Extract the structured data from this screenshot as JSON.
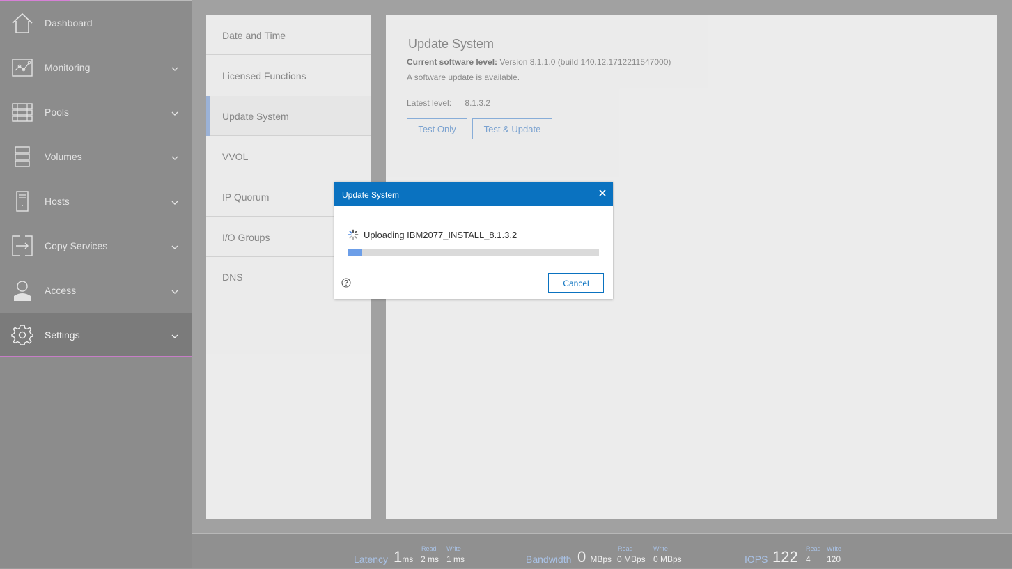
{
  "sidebar": {
    "items": [
      {
        "label": "Dashboard",
        "icon": "home-icon"
      },
      {
        "label": "Monitoring",
        "icon": "monitoring-icon"
      },
      {
        "label": "Pools",
        "icon": "pools-icon"
      },
      {
        "label": "Volumes",
        "icon": "volumes-icon"
      },
      {
        "label": "Hosts",
        "icon": "hosts-icon"
      },
      {
        "label": "Copy Services",
        "icon": "copy-services-icon"
      },
      {
        "label": "Access",
        "icon": "user-icon"
      },
      {
        "label": "Settings",
        "icon": "gear-icon"
      }
    ]
  },
  "settings_menu": {
    "items": [
      "Date and Time",
      "Licensed Functions",
      "Update System",
      "VVOL",
      "IP Quorum",
      "I/O Groups",
      "DNS"
    ],
    "active": "Update System"
  },
  "update_panel": {
    "title": "Update System",
    "current_label": "Current software level:",
    "current_value": "Version 8.1.1.0 (build 140.12.1712211547000)",
    "available_text": "A software update is available.",
    "latest_label": "Latest level:",
    "latest_value": "8.1.3.2",
    "test_only_label": "Test Only",
    "test_update_label": "Test & Update"
  },
  "modal": {
    "title": "Update System",
    "upload_text": "Uploading IBM2077_INSTALL_8.1.3.2",
    "progress_fraction": 0.055,
    "cancel_label": "Cancel",
    "accent_color": "#0a72c0"
  },
  "footer": {
    "latency": {
      "label": "Latency",
      "value": "1",
      "unit": "ms",
      "read_label": "Read",
      "read_value": "2 ms",
      "write_label": "Write",
      "write_value": "1 ms"
    },
    "bandwidth": {
      "label": "Bandwidth",
      "value": "0",
      "unit": "MBps",
      "read_label": "Read",
      "read_value": "0 MBps",
      "write_label": "Write",
      "write_value": "0 MBps"
    },
    "iops": {
      "label": "IOPS",
      "value": "122",
      "read_label": "Read",
      "read_value": "4",
      "write_label": "Write",
      "write_value": "120"
    }
  }
}
